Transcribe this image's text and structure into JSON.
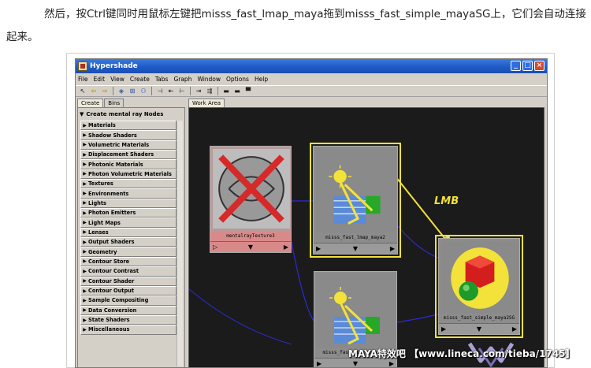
{
  "article": {
    "text": "然后，按Ctrl键同时用鼠标左键把misss_fast_lmap_maya拖到misss_fast_simple_mayaSG上，它们会自动连接起来。"
  },
  "window": {
    "title": "Hypershade",
    "controls": [
      "_",
      "□",
      "×"
    ],
    "menu": [
      "File",
      "Edit",
      "View",
      "Create",
      "Tabs",
      "Graph",
      "Window",
      "Options",
      "Help"
    ],
    "toolbar_icons": [
      "pointer-icon",
      "arrow-left-icon",
      "arrow-right-icon",
      "clear-graph-icon",
      "rearrange-icon",
      "graph-materials-icon",
      "input-connections-icon",
      "io-connections-icon",
      "output-connections-icon",
      "collapse-icon",
      "expand-icon",
      "split-icon",
      "single-pane-icon",
      "dash-icon"
    ]
  },
  "left_pane": {
    "tabs": [
      "Create",
      "Bins"
    ],
    "section_title": "Create mental ray Nodes",
    "categories": [
      "Materials",
      "Shadow Shaders",
      "Volumetric Materials",
      "Displacement Shaders",
      "Photonic Materials",
      "Photon Volumetric Materials",
      "Textures",
      "Environments",
      "Lights",
      "Photon Emitters",
      "Light Maps",
      "Lenses",
      "Output Shaders",
      "Geometry",
      "Contour Store",
      "Contour Contrast",
      "Contour Shader",
      "Contour Output",
      "Sample Compositing",
      "Data Conversion",
      "State Shaders",
      "Miscellaneous"
    ]
  },
  "work_area": {
    "tab": "Work Area",
    "annotation": "LMB",
    "nodes": {
      "texture": {
        "label": "mentalrayTexture3"
      },
      "lmap": {
        "label": "misss_fast_lmap_maya2"
      },
      "sg": {
        "label": "misss_fast_simple_maya2SG"
      },
      "simple": {
        "label": "misss_fast_simple_maya2"
      }
    },
    "port_glyphs": {
      "left": "▶",
      "middle": "▼",
      "right": "▶",
      "left_open": "▷"
    }
  },
  "watermark": {
    "text": "MAYA特效吧 【www.lineca.com/tieba/1745】"
  },
  "colors": {
    "title_bar": "#1e5bc6",
    "work_area_bg": "#1b1b1b",
    "selection": "#f2e23a",
    "connection": "#2b2bd6",
    "window_face": "#d4d0c8"
  }
}
